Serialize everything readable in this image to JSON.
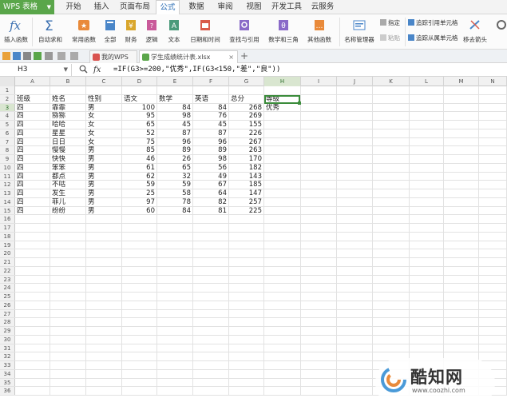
{
  "app": {
    "name": "WPS 表格"
  },
  "menu": {
    "tabs": [
      "开始",
      "插入",
      "页面布局",
      "公式",
      "数据",
      "审阅",
      "视图",
      "开发工具",
      "云服务"
    ],
    "active": "公式"
  },
  "ribbon": {
    "insert_function": "插入函数",
    "autosum": "自动求和",
    "common_functions": "常用函数",
    "all": "全部",
    "financial": "财务",
    "logical": "逻辑",
    "text": "文本",
    "date_time": "日期和时间",
    "lookup_ref": "查找与引用",
    "math_trig": "数学和三角",
    "other_functions": "其他函数",
    "name_manager": "名称管理器",
    "paste": "指定",
    "paste2": "粘贴",
    "trace_precedents": "追踪引用单元格",
    "trace_dependents": "追踪从属单元格",
    "remove_arrows": "移去箭头"
  },
  "tabs": {
    "home": "我的WPS",
    "doc": "学生成绩统计表.xlsx",
    "close": "×",
    "add": "+"
  },
  "formula_bar": {
    "cell_ref": "H3",
    "fx": "fx",
    "formula": "=IF(G3>=200,\"优秀\",IF(G3<150,\"差\",\"良\"))"
  },
  "grid": {
    "columns": [
      "A",
      "B",
      "C",
      "D",
      "E",
      "F",
      "G",
      "H",
      "I",
      "J",
      "K",
      "L",
      "M",
      "N"
    ],
    "selected_column": "H",
    "selected_row": 3,
    "row_count": 36,
    "header_row": [
      "班级",
      "姓名",
      "性别",
      "语文",
      "数学",
      "英语",
      "总分",
      "等级"
    ],
    "data_rows": [
      [
        "四",
        "霏霏",
        "男",
        "100",
        "84",
        "84",
        "268",
        "优秀"
      ],
      [
        "四",
        "猕猕",
        "女",
        "95",
        "98",
        "76",
        "269",
        ""
      ],
      [
        "四",
        "哈哈",
        "女",
        "65",
        "45",
        "45",
        "155",
        ""
      ],
      [
        "四",
        "星星",
        "女",
        "52",
        "87",
        "87",
        "226",
        ""
      ],
      [
        "四",
        "日日",
        "女",
        "75",
        "96",
        "96",
        "267",
        ""
      ],
      [
        "四",
        "慢慢",
        "男",
        "85",
        "89",
        "89",
        "263",
        ""
      ],
      [
        "四",
        "快快",
        "男",
        "46",
        "26",
        "98",
        "170",
        ""
      ],
      [
        "四",
        "笨笨",
        "男",
        "61",
        "65",
        "56",
        "182",
        ""
      ],
      [
        "四",
        "都点",
        "男",
        "62",
        "32",
        "49",
        "143",
        ""
      ],
      [
        "四",
        "不咕",
        "男",
        "59",
        "59",
        "67",
        "185",
        ""
      ],
      [
        "四",
        "发生",
        "男",
        "25",
        "58",
        "64",
        "147",
        ""
      ],
      [
        "四",
        "菲儿",
        "男",
        "97",
        "78",
        "82",
        "257",
        ""
      ],
      [
        "四",
        "纷纷",
        "男",
        "60",
        "84",
        "81",
        "225",
        ""
      ]
    ]
  },
  "watermark": {
    "name": "酷知网",
    "url": "www.coozhi.com"
  }
}
